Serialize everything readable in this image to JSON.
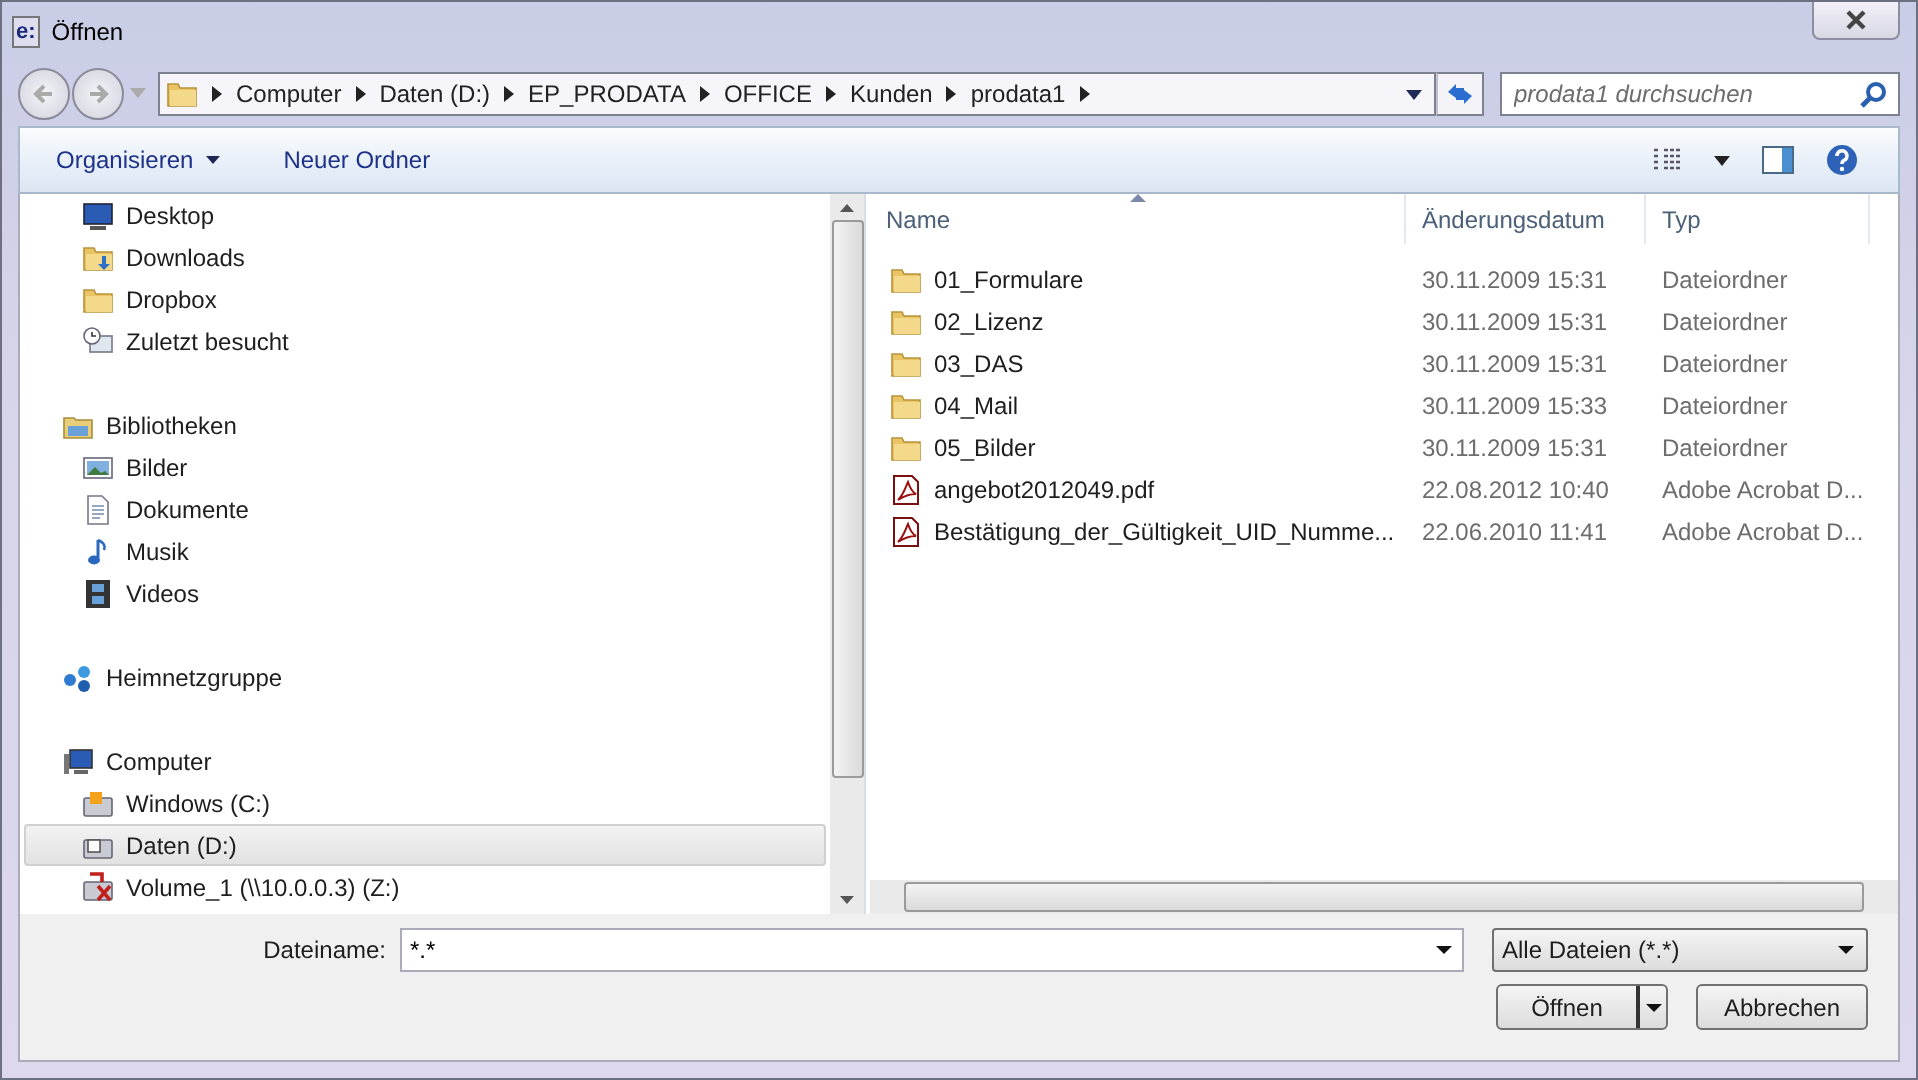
{
  "window": {
    "title": "Öffnen",
    "app_icon_text": "e:"
  },
  "breadcrumbs": [
    "Computer",
    "Daten (D:)",
    "EP_PRODATA",
    "OFFICE",
    "Kunden",
    "prodata1"
  ],
  "search": {
    "placeholder": "prodata1 durchsuchen"
  },
  "toolbar": [
    {
      "label": "Organisieren",
      "dropdown": true
    },
    {
      "label": "Neuer Ordner",
      "dropdown": false
    }
  ],
  "nav_sections": [
    {
      "children": [
        {
          "label": "Desktop",
          "kind": "desktop",
          "selected": false
        },
        {
          "label": "Downloads",
          "kind": "downloads",
          "selected": false
        },
        {
          "label": "Dropbox",
          "kind": "folder",
          "selected": false
        },
        {
          "label": "Zuletzt besucht",
          "kind": "recent",
          "selected": false
        }
      ]
    },
    {
      "label": "Bibliotheken",
      "kind": "library",
      "selected": false,
      "children": [
        {
          "label": "Bilder",
          "kind": "pictures",
          "selected": false
        },
        {
          "label": "Dokumente",
          "kind": "documents",
          "selected": false
        },
        {
          "label": "Musik",
          "kind": "music",
          "selected": false
        },
        {
          "label": "Videos",
          "kind": "videos",
          "selected": false
        }
      ]
    },
    {
      "label": "Heimnetzgruppe",
      "kind": "homegroup",
      "selected": false
    },
    {
      "label": "Computer",
      "kind": "computer",
      "selected": false,
      "children": [
        {
          "label": "Windows (C:)",
          "kind": "system-drive",
          "selected": false
        },
        {
          "label": "Daten (D:)",
          "kind": "drive",
          "selected": true
        },
        {
          "label": "Volume_1 (\\\\10.0.0.3) (Z:)",
          "kind": "network-drive",
          "selected": false
        }
      ]
    }
  ],
  "table": {
    "columns": [
      {
        "label": "Name",
        "sorted": true
      },
      {
        "label": "Änderungsdatum",
        "sorted": false
      },
      {
        "label": "Typ",
        "sorted": false
      }
    ],
    "rows": [
      {
        "kind": "folder",
        "name": "01_Formulare",
        "date": "30.11.2009 15:31",
        "type": "Dateiordner"
      },
      {
        "kind": "folder",
        "name": "02_Lizenz",
        "date": "30.11.2009 15:31",
        "type": "Dateiordner"
      },
      {
        "kind": "folder",
        "name": "03_DAS",
        "date": "30.11.2009 15:31",
        "type": "Dateiordner"
      },
      {
        "kind": "folder",
        "name": "04_Mail",
        "date": "30.11.2009 15:33",
        "type": "Dateiordner"
      },
      {
        "kind": "folder",
        "name": "05_Bilder",
        "date": "30.11.2009 15:31",
        "type": "Dateiordner"
      },
      {
        "kind": "pdf",
        "name": "angebot2012049.pdf",
        "date": "22.08.2012 10:40",
        "type": "Adobe Acrobat D..."
      },
      {
        "kind": "pdf",
        "name": "Bestätigung_der_Gültigkeit_UID_Numme...",
        "date": "22.06.2010 11:41",
        "type": "Adobe Acrobat D..."
      }
    ]
  },
  "filename": {
    "label": "Dateiname:",
    "value": "*.*"
  },
  "filter": {
    "value": "Alle Dateien (*.*)"
  },
  "buttons": [
    {
      "label": "Öffnen",
      "split": true
    },
    {
      "label": "Abbrechen",
      "split": false
    }
  ]
}
